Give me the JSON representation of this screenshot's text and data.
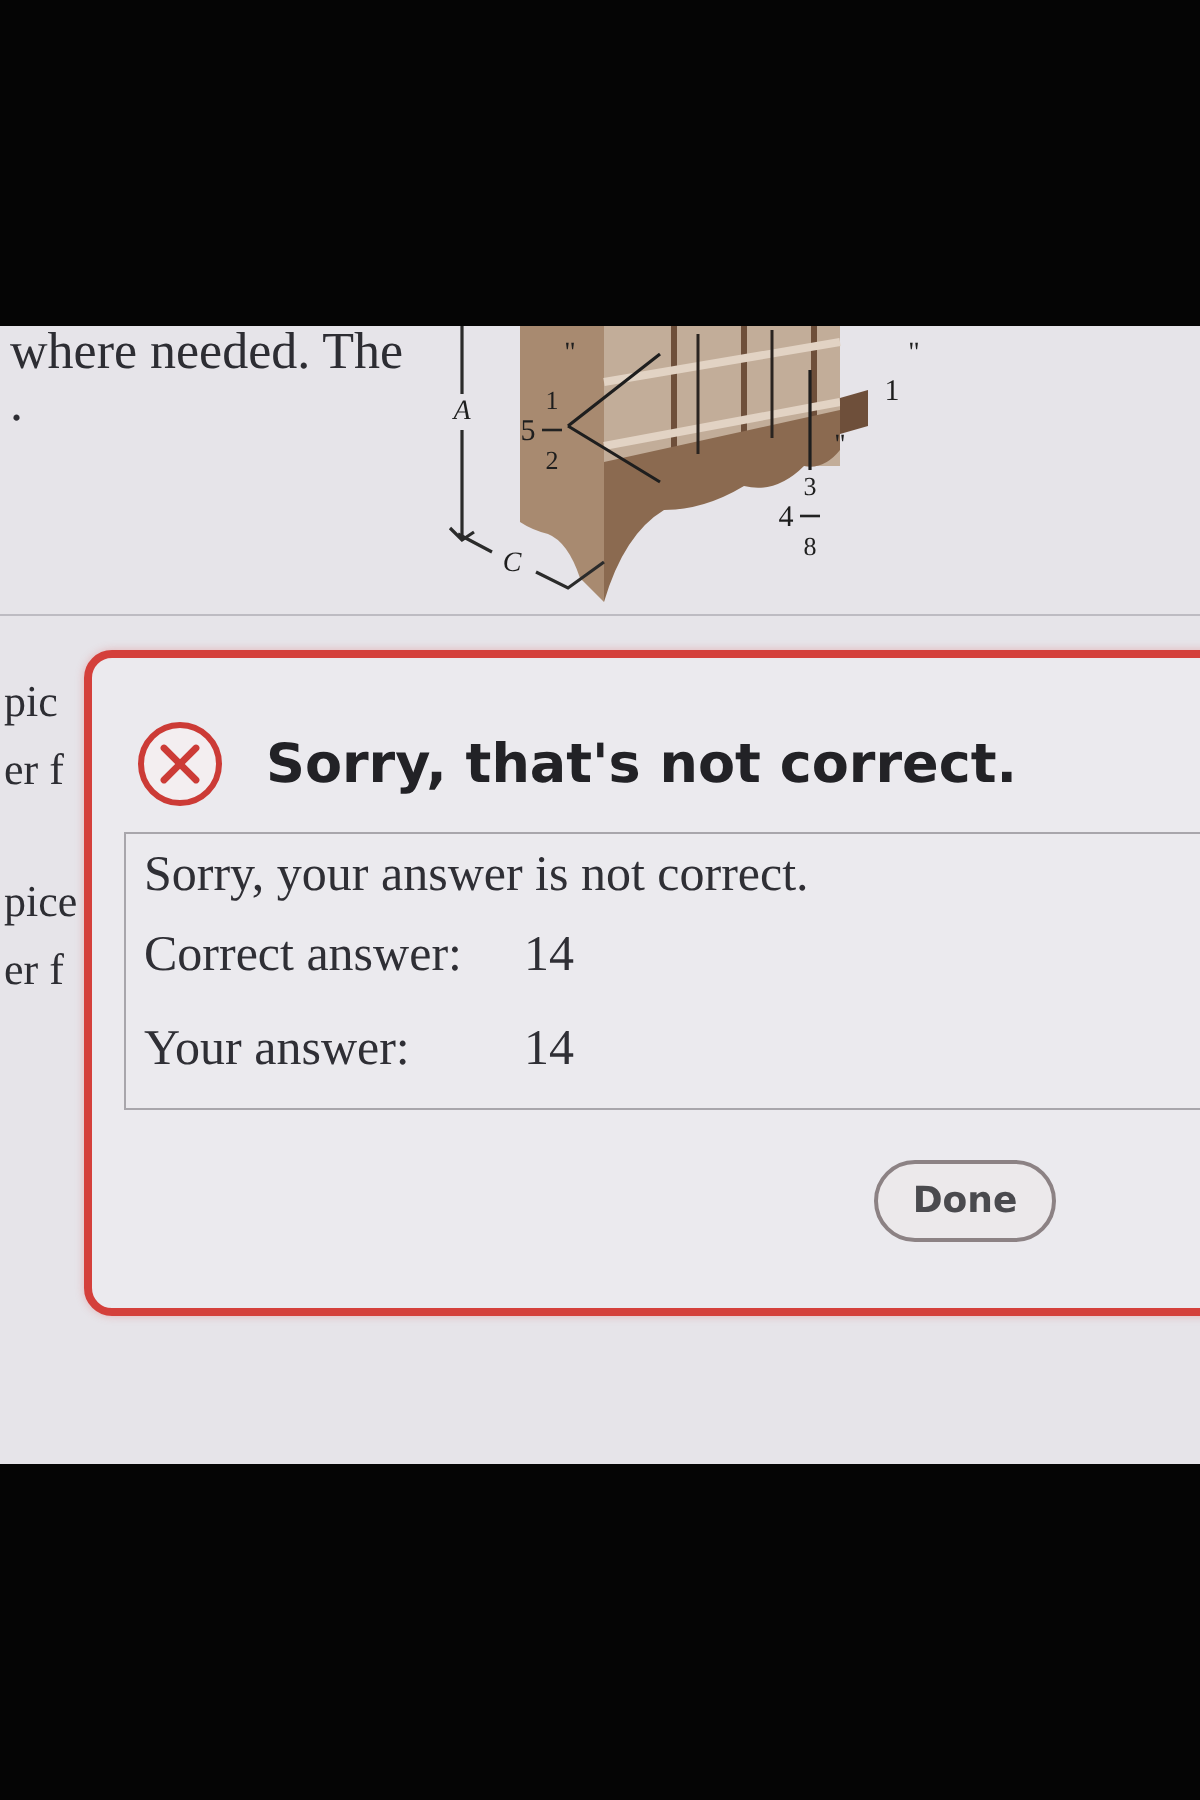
{
  "page": {
    "text_lines": [
      "where needed. The",
      "."
    ],
    "fragments": [
      "pic",
      "er f",
      "pice",
      "er f"
    ]
  },
  "figure": {
    "labels": [
      {
        "kind": "letter",
        "text": "A"
      },
      {
        "kind": "unit",
        "text": "\""
      },
      {
        "kind": "fraction",
        "whole": "5",
        "numerator": "1",
        "denominator": "2"
      },
      {
        "kind": "number",
        "text": "1"
      },
      {
        "kind": "unit",
        "text": "\""
      },
      {
        "kind": "unit",
        "text": "\""
      },
      {
        "kind": "fraction",
        "whole": "4",
        "numerator": "3",
        "denominator": "8"
      },
      {
        "kind": "letter",
        "text": "C"
      }
    ]
  },
  "dialog": {
    "title": "Sorry, that's not correct.",
    "message": "Sorry, your answer is not correct.",
    "rows": [
      {
        "label": "Correct answer:",
        "value": "14"
      },
      {
        "label": "Your answer:",
        "value": "14"
      }
    ],
    "buttons": [
      "Done"
    ]
  }
}
